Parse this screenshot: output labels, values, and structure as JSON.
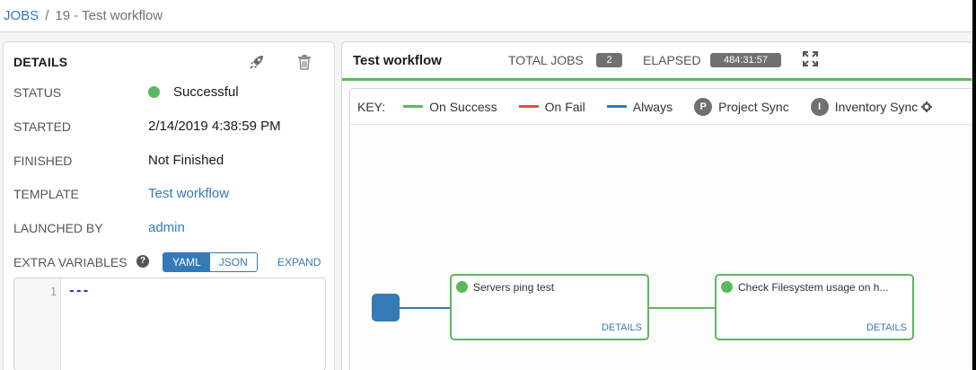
{
  "breadcrumb": {
    "root": "JOBS",
    "separator": "/",
    "current": "19 - Test workflow"
  },
  "details": {
    "title": "DETAILS",
    "status_label": "STATUS",
    "status_value": "Successful",
    "started_label": "STARTED",
    "started_value": "2/14/2019 4:38:59 PM",
    "finished_label": "FINISHED",
    "finished_value": "Not Finished",
    "template_label": "TEMPLATE",
    "template_value": "Test workflow",
    "launched_by_label": "LAUNCHED BY",
    "launched_by_value": "admin",
    "extra_vars_label": "EXTRA VARIABLES",
    "help_glyph": "?",
    "yaml_label": "YAML",
    "json_label": "JSON",
    "expand_label": "EXPAND",
    "code_line_number": "1",
    "code_text": "---",
    "icons": [
      "rocket-icon",
      "trash-icon",
      "help-icon"
    ]
  },
  "workflow": {
    "title": "Test workflow",
    "total_jobs_label": "TOTAL JOBS",
    "total_jobs_value": "2",
    "elapsed_label": "ELAPSED",
    "elapsed_value": "484:31:57",
    "key": {
      "title": "KEY:",
      "on_success": "On Success",
      "on_fail": "On Fail",
      "always": "Always",
      "project_sync_glyph": "P",
      "project_sync": "Project Sync",
      "inventory_sync_glyph": "I",
      "inventory_sync": "Inventory Sync"
    },
    "nodes": [
      {
        "name": "Servers ping test",
        "details": "DETAILS"
      },
      {
        "name": "Check Filesystem usage on h...",
        "details": "DETAILS"
      }
    ]
  },
  "colors": {
    "success": "#5cb85c",
    "fail": "#d9534f",
    "always": "#337ab7",
    "link": "#337ab7",
    "badge": "#707070"
  }
}
